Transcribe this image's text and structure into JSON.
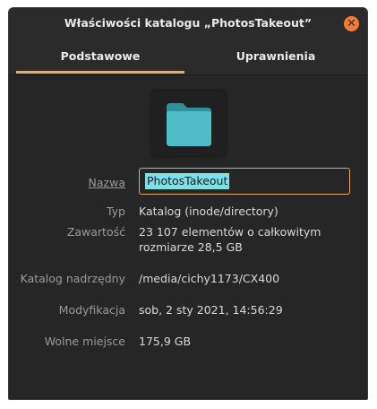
{
  "window": {
    "title": "Właściwości katalogu „PhotosTakeout”",
    "close_label": "✕"
  },
  "tabs": [
    {
      "label": "Podstawowe",
      "active": true
    },
    {
      "label": "Uprawnienia",
      "active": false
    }
  ],
  "icon": {
    "name": "folder-icon",
    "color": "#4fbcc8"
  },
  "fields": {
    "name_label": "Nazwa",
    "name_value": "PhotosTakeout",
    "type_label": "Typ",
    "type_value": "Katalog (inode/directory)",
    "contents_label": "Zawartość",
    "contents_line1": "23 107 elementów o całkowitym",
    "contents_line2": "rozmiarze 28,5 GB",
    "parent_label": "Katalog nadrzędny",
    "parent_value": "/media/cichy1173/CX400",
    "modified_label": "Modyfikacja",
    "modified_value": "sob, 2 sty 2021, 14:56:29",
    "free_label": "Wolne miejsce",
    "free_value": "175,9 GB"
  },
  "colors": {
    "accent": "#f3a85d",
    "close": "#f37c3a",
    "selection": "#7fe0ea",
    "background": "#262626"
  }
}
